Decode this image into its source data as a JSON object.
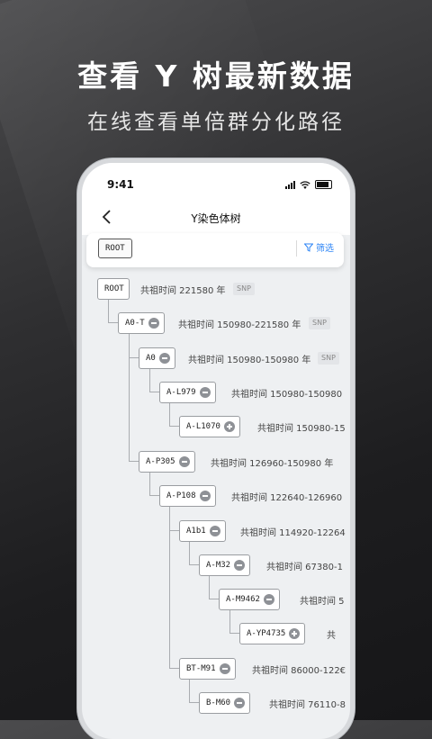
{
  "hero": {
    "title": "查看 Y 树最新数据",
    "subtitle": "在线查看单倍群分化路径"
  },
  "status_bar": {
    "time": "9:41"
  },
  "nav": {
    "title": "Y染色体树",
    "back_icon": "chevron-left-icon"
  },
  "filter_bar": {
    "root_chip": "ROOT",
    "filter_label": "筛选",
    "filter_icon": "funnel-icon",
    "accent_color": "#2f86f6"
  },
  "tree": {
    "nodes": [
      {
        "id": "ROOT",
        "time": "共祖时间 221580 年",
        "badge": "SNP",
        "icon": null
      },
      {
        "id": "A0-T",
        "time": "共祖时间 150980-221580 年",
        "badge": "SNP",
        "icon": "minus"
      },
      {
        "id": "A0",
        "time": "共祖时间 150980-150980 年",
        "badge": "SNP",
        "icon": "minus"
      },
      {
        "id": "A-L979",
        "time": "共祖时间 150980-150980",
        "badge": null,
        "icon": "minus"
      },
      {
        "id": "A-L1070",
        "time": "共祖时间 150980-15",
        "badge": null,
        "icon": "plus"
      },
      {
        "id": "A-P305",
        "time": "共祖时间 126960-150980 年",
        "badge": null,
        "icon": "minus"
      },
      {
        "id": "A-P108",
        "time": "共祖时间 122640-126960",
        "badge": null,
        "icon": "minus"
      },
      {
        "id": "A1b1",
        "time": "共祖时间 114920-12264",
        "badge": null,
        "icon": "minus"
      },
      {
        "id": "A-M32",
        "time": "共祖时间 67380-1",
        "badge": null,
        "icon": "minus"
      },
      {
        "id": "A-M9462",
        "time": "共祖时间 5",
        "badge": null,
        "icon": "minus"
      },
      {
        "id": "A-YP4735",
        "time": "共",
        "badge": null,
        "icon": "plus"
      },
      {
        "id": "BT-M91",
        "time": "共祖时间 86000-122€",
        "badge": null,
        "icon": "minus"
      },
      {
        "id": "B-M60",
        "time": "共祖时间 76110-8",
        "badge": null,
        "icon": "minus"
      }
    ]
  }
}
